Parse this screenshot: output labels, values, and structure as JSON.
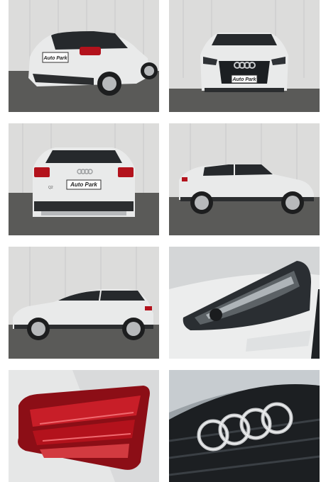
{
  "gallery": {
    "plate_text": "Auto Park",
    "model_badge": "Q2",
    "photos": [
      {
        "view": "rear-three-quarter"
      },
      {
        "view": "front"
      },
      {
        "view": "rear"
      },
      {
        "view": "side-right"
      },
      {
        "view": "side-left"
      },
      {
        "view": "headlight-detail"
      },
      {
        "view": "taillight-detail"
      },
      {
        "view": "grille-rings-detail"
      }
    ]
  },
  "colors": {
    "car_body": "#e9eaea",
    "wall": "#dcdcdb",
    "ground": "#5a5a58",
    "glass": "#26292c",
    "taillight": "#b3121c",
    "grille": "#1c1f22",
    "chrome": "#c8cacc"
  }
}
